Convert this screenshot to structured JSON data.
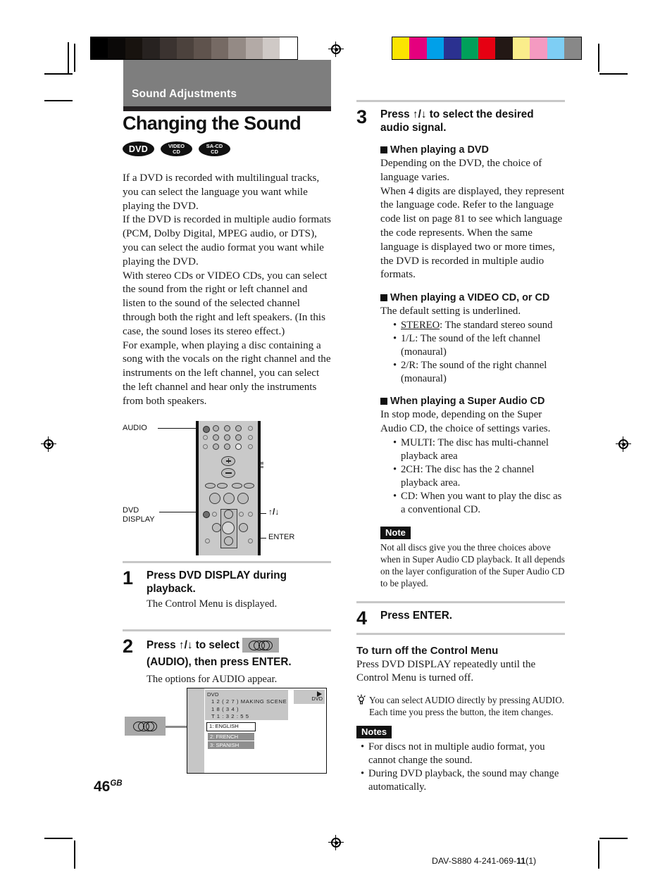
{
  "chapter": {
    "label": "Sound Adjustments"
  },
  "title": "Changing the Sound",
  "disc_logos": [
    {
      "name": "dvd-logo",
      "line1": "DVD",
      "line2": ""
    },
    {
      "name": "video-cd-logo",
      "line1": "VIDEO",
      "line2": "CD"
    },
    {
      "name": "sacd-cd-logo",
      "line1": "SA-CD",
      "line2": "CD"
    }
  ],
  "intro": "If a DVD is recorded with multilingual tracks, you can select the language you want while playing the DVD.\nIf the DVD is recorded in multiple audio formats (PCM, Dolby Digital, MPEG audio, or DTS), you can select the audio format you want while playing the DVD.\nWith stereo CDs or VIDEO CDs, you can select the sound from the right or left channel and listen to the sound of the selected channel through both the right and left speakers. (In this case, the sound loses its stereo effect.)\nFor example, when playing a disc containing a song with the vocals on the right channel and the instruments on the left channel, you can select the left channel and hear only the instruments from both speakers.",
  "remote": {
    "label_audio": "AUDIO",
    "label_dvd_display_line1": "DVD",
    "label_dvd_display_line2": "DISPLAY",
    "label_updown": "↑/↓",
    "label_enter": "ENTER"
  },
  "steps": [
    {
      "number": "1",
      "heading": "Press DVD DISPLAY during playback.",
      "sub": "The Control Menu is displayed."
    },
    {
      "number": "2",
      "heading_pre": "Press ↑/↓ to select",
      "heading_post": "(AUDIO), then press ENTER.",
      "sub": "The options for AUDIO appear."
    },
    {
      "number": "3",
      "heading": "Press ↑/↓ to select the desired audio signal."
    },
    {
      "number": "4",
      "heading": "Press ENTER."
    }
  ],
  "tv_screen": {
    "info_title": "DVD",
    "info_line1": "1 2 ( 2 7 ) MAKING SCENE",
    "info_line2": "1 8 ( 3 4 )",
    "info_line3": "T    1 : 3 2 : 5 5",
    "corner_label": "DVD",
    "options": [
      {
        "label": "1: ENGLISH",
        "selected": true
      },
      {
        "label": "2: FRENCH",
        "selected": false
      },
      {
        "label": "3: SPANISH",
        "selected": false
      }
    ]
  },
  "page_number": {
    "number": "46",
    "suffix": "GB"
  },
  "sections": [
    {
      "id": "dvd",
      "heading": "When playing a DVD",
      "body": "Depending on the DVD, the choice of language varies.\nWhen 4 digits are displayed, they represent the language code. Refer to the language code list on page 81 to see which language the code represents. When the same language is displayed two or more times, the DVD is recorded in multiple audio formats."
    },
    {
      "id": "videocd",
      "heading": "When playing a VIDEO CD, or CD",
      "body": "The default setting is underlined.",
      "bullets": [
        {
          "term": "STEREO",
          "underline": true,
          "rest": ": The standard stereo sound"
        },
        {
          "term": "1/L",
          "underline": false,
          "rest": ": The sound of the left channel (monaural)"
        },
        {
          "term": "2/R",
          "underline": false,
          "rest": ": The sound of the right channel (monaural)"
        }
      ]
    },
    {
      "id": "sacd",
      "heading": "When playing a Super Audio CD",
      "body": "In stop mode, depending on the Super Audio CD, the choice of settings varies.",
      "bullets": [
        {
          "term": "MULTI",
          "underline": false,
          "rest": ": The disc has multi-channel playback area"
        },
        {
          "term": "2CH",
          "underline": false,
          "rest": ": The disc has the 2 channel playback area."
        },
        {
          "term": "CD",
          "underline": false,
          "rest": ": When you want to play the disc as a conventional CD."
        }
      ]
    }
  ],
  "note": {
    "tag": "Note",
    "body": "Not all discs give you the three choices above when in Super Audio CD playback. It all depends on the layer configuration of the Super Audio CD to be played."
  },
  "turn_off": {
    "heading": "To turn off the Control Menu",
    "body": "Press DVD DISPLAY repeatedly until the Control Menu is turned off."
  },
  "tip": {
    "body": "You can select AUDIO directly by pressing AUDIO. Each time you press the button, the item changes."
  },
  "notes": {
    "tag": "Notes",
    "items": [
      "For discs not in multiple audio format, you cannot change the sound.",
      "During DVD playback, the sound may change automatically."
    ]
  },
  "footer": {
    "model": "DAV-S880 4-241-069-",
    "rev": "11",
    "paren": "(1)"
  },
  "calibration": {
    "grey_steps": [
      "#000000",
      "#0b0908",
      "#18130f",
      "#272220",
      "#3b3330",
      "#4c423d",
      "#5f534d",
      "#766a64",
      "#948a85",
      "#b3aaa6",
      "#cfc9c6",
      "#ffffff"
    ],
    "color_steps": [
      "#fbe500",
      "#e5007e",
      "#00a0e9",
      "#2b3190",
      "#00a05a",
      "#e60012",
      "#231815",
      "#faed8b",
      "#f49ac1",
      "#7ecef4",
      "#888888"
    ]
  }
}
